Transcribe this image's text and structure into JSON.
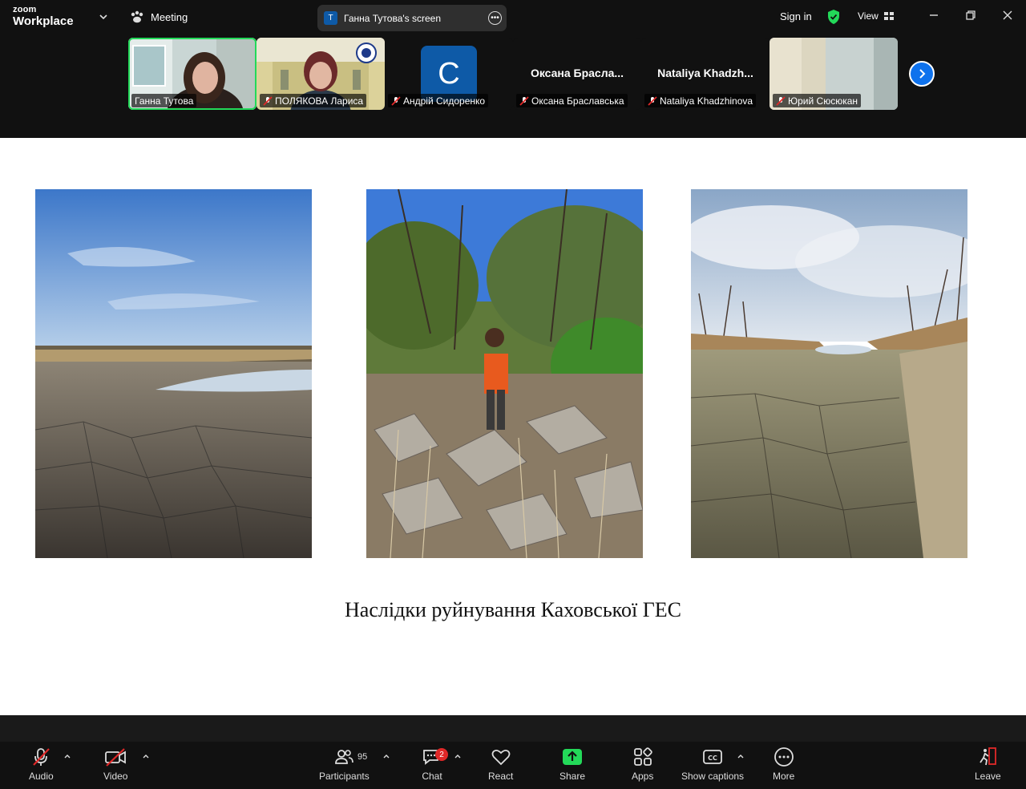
{
  "app": {
    "brand_top": "zoom",
    "brand_bottom": "Workplace"
  },
  "header": {
    "meeting_label": "Meeting",
    "screen_share_avatar": "T",
    "screen_share_label": "Ганна Тутова's screen",
    "sign_in": "Sign in",
    "view_label": "View"
  },
  "participants": [
    {
      "name": "Ганна Тутова",
      "muted": false,
      "active": true
    },
    {
      "name": "ПОЛЯКОВА Лариса",
      "muted": true
    },
    {
      "name": "Андрій Сидоренко",
      "muted": true,
      "avatar_letter": "C"
    },
    {
      "name": "Оксана Браславська",
      "display": "Оксана  Браслa...",
      "muted": true
    },
    {
      "name": "Nataliya Khadzhinova",
      "display": "Nataliya  Khadzh...",
      "muted": true
    },
    {
      "name": "Юрий Сюсюкан",
      "muted": true
    }
  ],
  "slide": {
    "caption": "Наслідки руйнування Каховської ГЕС"
  },
  "toolbar": {
    "audio": "Audio",
    "video": "Video",
    "participants": "Participants",
    "participants_count": "95",
    "chat": "Chat",
    "chat_badge": "2",
    "react": "React",
    "share": "Share",
    "apps": "Apps",
    "captions": "Show captions",
    "more": "More",
    "leave": "Leave"
  },
  "colors": {
    "accent": "#0e72ed",
    "share_green": "#23d959",
    "mute_red": "#e02828"
  }
}
